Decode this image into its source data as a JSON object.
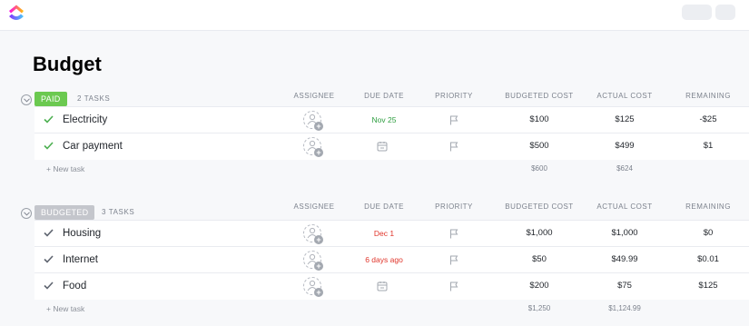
{
  "app": {
    "logo": "clickup-logo"
  },
  "page": {
    "title": "Budget"
  },
  "columns": {
    "assignee": "ASSIGNEE",
    "due_date": "DUE DATE",
    "priority": "PRIORITY",
    "budgeted_cost": "BUDGETED COST",
    "actual_cost": "ACTUAL COST",
    "remaining": "REMAINING"
  },
  "groups": [
    {
      "status": "PAID",
      "status_color": "#6bc950",
      "count": "2 TASKS",
      "tasks": [
        {
          "name": "Electricity",
          "due": "Nov 25",
          "due_color": "green",
          "budgeted": "$100",
          "actual": "$125",
          "remaining": "-$25"
        },
        {
          "name": "Car payment",
          "due": "",
          "budgeted": "$500",
          "actual": "$499",
          "remaining": "$1"
        }
      ],
      "new_task": "+ New task",
      "total_budgeted": "$600",
      "total_actual": "$624"
    },
    {
      "status": "BUDGETED",
      "status_color": "#c4c6cc",
      "count": "3 TASKS",
      "tasks": [
        {
          "name": "Housing",
          "due": "Dec 1",
          "due_color": "red",
          "budgeted": "$1,000",
          "actual": "$1,000",
          "remaining": "$0"
        },
        {
          "name": "Internet",
          "due": "6 days ago",
          "due_color": "red",
          "budgeted": "$50",
          "actual": "$49.99",
          "remaining": "$0.01"
        },
        {
          "name": "Food",
          "due": "",
          "budgeted": "$200",
          "actual": "$75",
          "remaining": "$125"
        }
      ],
      "new_task": "+ New task",
      "total_budgeted": "$1,250",
      "total_actual": "$1,124.99"
    }
  ]
}
